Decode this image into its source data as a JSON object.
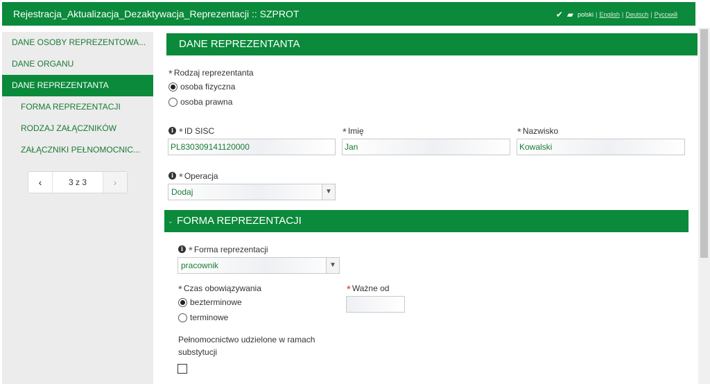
{
  "header": {
    "title": "Rejestracja_Aktualizacja_Dezaktywacja_Reprezentacji :: SZPROT",
    "languages": {
      "current": "polski",
      "links": [
        "English",
        "Deutsch",
        "Русский"
      ],
      "separator": "|"
    }
  },
  "sidebar": {
    "items": [
      {
        "label": "DANE OSOBY REPREZENTOWA..."
      },
      {
        "label": "DANE ORGANU"
      },
      {
        "label": "DANE REPREZENTANTA"
      },
      {
        "label": "FORMA REPREZENTACJI"
      },
      {
        "label": "RODZAJ ZAŁĄCZNIKÓW"
      },
      {
        "label": "ZAŁĄCZNIKI PEŁNOMOCNIC..."
      }
    ],
    "pager": {
      "prev": "‹",
      "info": "3 z 3",
      "next": "›"
    }
  },
  "section1": {
    "title": "DANE REPREZENTANTA",
    "rodzaj_label": "Rodzaj reprezentanta",
    "rodzaj_options": [
      "osoba fizyczna",
      "osoba prawna"
    ],
    "id_sisc_label": "ID SISC",
    "id_sisc_value": "PL830309141120000",
    "imie_label": "Imię",
    "imie_value": "Jan",
    "nazwisko_label": "Nazwisko",
    "nazwisko_value": "Kowalski",
    "operacja_label": "Operacja",
    "operacja_value": "Dodaj"
  },
  "section2": {
    "title": "FORMA REPREZENTACJI",
    "forma_label": "Forma reprezentacji",
    "forma_value": "pracownik",
    "czas_label": "Czas obowiązywania",
    "czas_options": [
      "bezterminowe",
      "terminowe"
    ],
    "wazne_od_label": "Ważne od",
    "wazne_od_value": "",
    "substytucja_label_1": "Pełnomocnictwo udzielone w ramach",
    "substytucja_label_2": "substytucji"
  },
  "colors": {
    "brand": "#0a8a3a",
    "required_marker": "#d9302f",
    "value_text": "#1a7a33"
  },
  "icons": [
    "check-icon",
    "print-icon",
    "info-icon",
    "chevron-left-icon",
    "chevron-right-icon",
    "dropdown-arrow-icon"
  ]
}
